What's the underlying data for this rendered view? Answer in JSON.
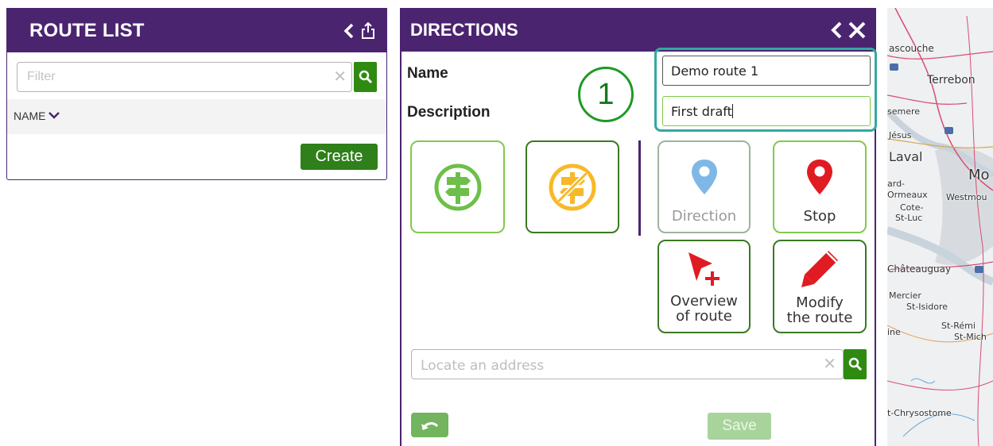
{
  "route_list": {
    "title": "ROUTE LIST",
    "filter_placeholder": "Filter",
    "name_column": "NAME",
    "create_label": "Create"
  },
  "directions": {
    "title": "DIRECTIONS",
    "name_label": "Name",
    "description_label": "Description",
    "step_badge": "1",
    "name_value": "Demo route 1",
    "description_value": "First draft",
    "tiles": {
      "direction_label": "Direction",
      "stop_label": "Stop",
      "overview_line1": "Overview",
      "overview_line2": "of route",
      "modify_line1": "Modify",
      "modify_line2": "the route"
    },
    "locate_placeholder": "Locate an address",
    "save_label": "Save"
  },
  "map": {
    "labels": [
      "ascouche",
      "Terrebon",
      "semere",
      "Jésus",
      "Laval",
      "Mo",
      "ard-",
      "Ormeaux",
      "Westmou",
      "Cote-",
      "St-Luc",
      "Châteauguay",
      "Mercier",
      "St-Isidore",
      "St-Rémi",
      "ine",
      "St-Mich",
      "t-Chrysostome"
    ]
  },
  "colors": {
    "header_purple": "#4b2470",
    "green_primary": "#2f8a12",
    "teal_highlight": "#34a8a0",
    "stop_red": "#e11b22",
    "direction_blue": "#7fb8e6",
    "no_direction_yellow": "#f7b928"
  }
}
